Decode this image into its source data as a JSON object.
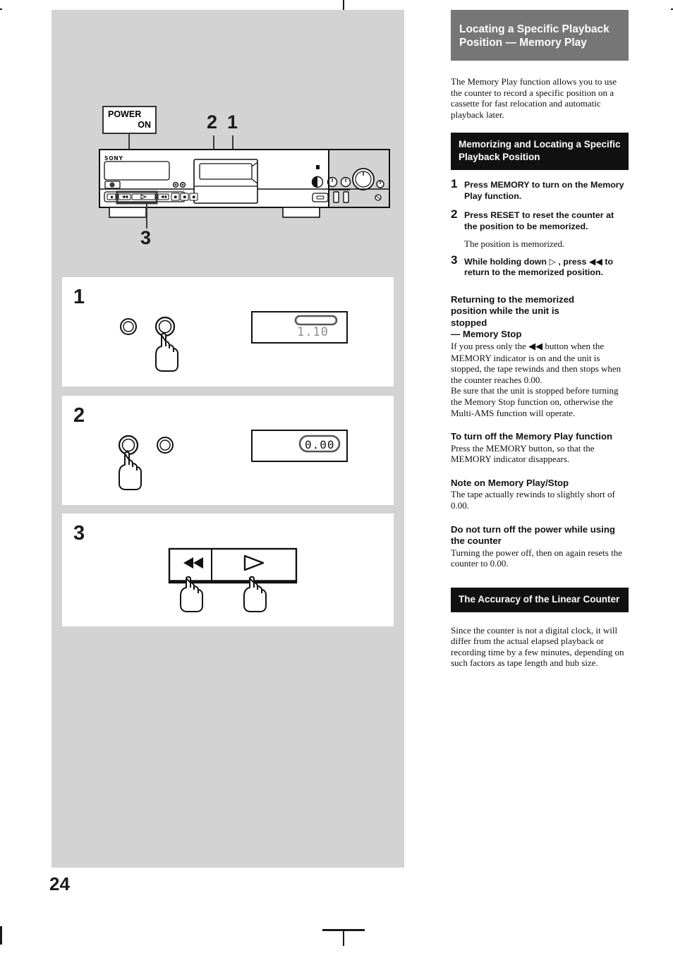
{
  "page": {
    "number": "24"
  },
  "illustration": {
    "power_label_line1": "POWER",
    "power_label_line2": "ON",
    "brand": "SONY",
    "callouts": {
      "one": "1",
      "two": "2",
      "three": "3"
    }
  },
  "steps": [
    {
      "number": "1",
      "display_value": "1.10",
      "display_style": "memory-indicator-on"
    },
    {
      "number": "2",
      "display_value": "0.00",
      "display_style": "counter-boxed"
    },
    {
      "number": "3",
      "buttons": [
        {
          "icon": "rewind-icon",
          "glyph": "◀◀"
        },
        {
          "icon": "play-icon",
          "glyph": "▷"
        }
      ]
    }
  ],
  "right_column": {
    "title": "Locating a Specific Playback Position — Memory Play",
    "intro": "The Memory Play function allows you to use the counter to record a specific position on a cassette for fast relocation and automatic playback later.",
    "section1_header": "Memorizing and Locating a Specific Playback Position",
    "procedure": [
      {
        "number": "1",
        "text": "Press MEMORY to turn on the Memory Play function."
      },
      {
        "number": "2",
        "text": "Press RESET to reset the counter at the position to be memorized."
      },
      {
        "number": "3",
        "text_prefix": "While holding down ",
        "play_glyph": "▷",
        "text_middle": " , press ",
        "rewind_glyph": "◀◀",
        "text_suffix": " to return to the memorized position."
      }
    ],
    "procedure_note": "The position is memorized.",
    "subsections": [
      {
        "heading_line1": "Returning to the memorized",
        "heading_line2": "position while the unit is",
        "heading_line3": "stopped",
        "heading_line4": "— Memory Stop",
        "body_part1": "If you press only the ",
        "rewind_glyph": "◀◀",
        "body_part2": " button when the MEMORY indicator is on and the unit is stopped, the tape rewinds and then stops when the counter reaches 0.00.",
        "body_part3": "Be sure that the unit is stopped before turning the Memory Stop function on, otherwise the Multi-AMS function will operate."
      },
      {
        "heading": "To turn off the Memory Play function",
        "body": "Press the MEMORY button, so that the MEMORY indicator disappears."
      },
      {
        "heading": "Note on Memory Play/Stop",
        "body": "The tape actually rewinds to slightly short of 0.00."
      },
      {
        "heading": "Do not turn off the power while using the counter",
        "body": "Turning the power off,  then on again resets the counter to 0.00."
      }
    ],
    "section2_header": "The Accuracy of the Linear Counter",
    "section2_body": "Since the counter is not a digital clock, it will differ from the actual elapsed playback or recording time by a few minutes, depending on such factors as tape length and hub size."
  },
  "colors": {
    "page_background": "#ffffff",
    "illustration_background": "#d3d3d3",
    "title_banner": "#767676",
    "section_banner": "#111111",
    "panel_background": "#ffffff",
    "ink": "#111111"
  }
}
